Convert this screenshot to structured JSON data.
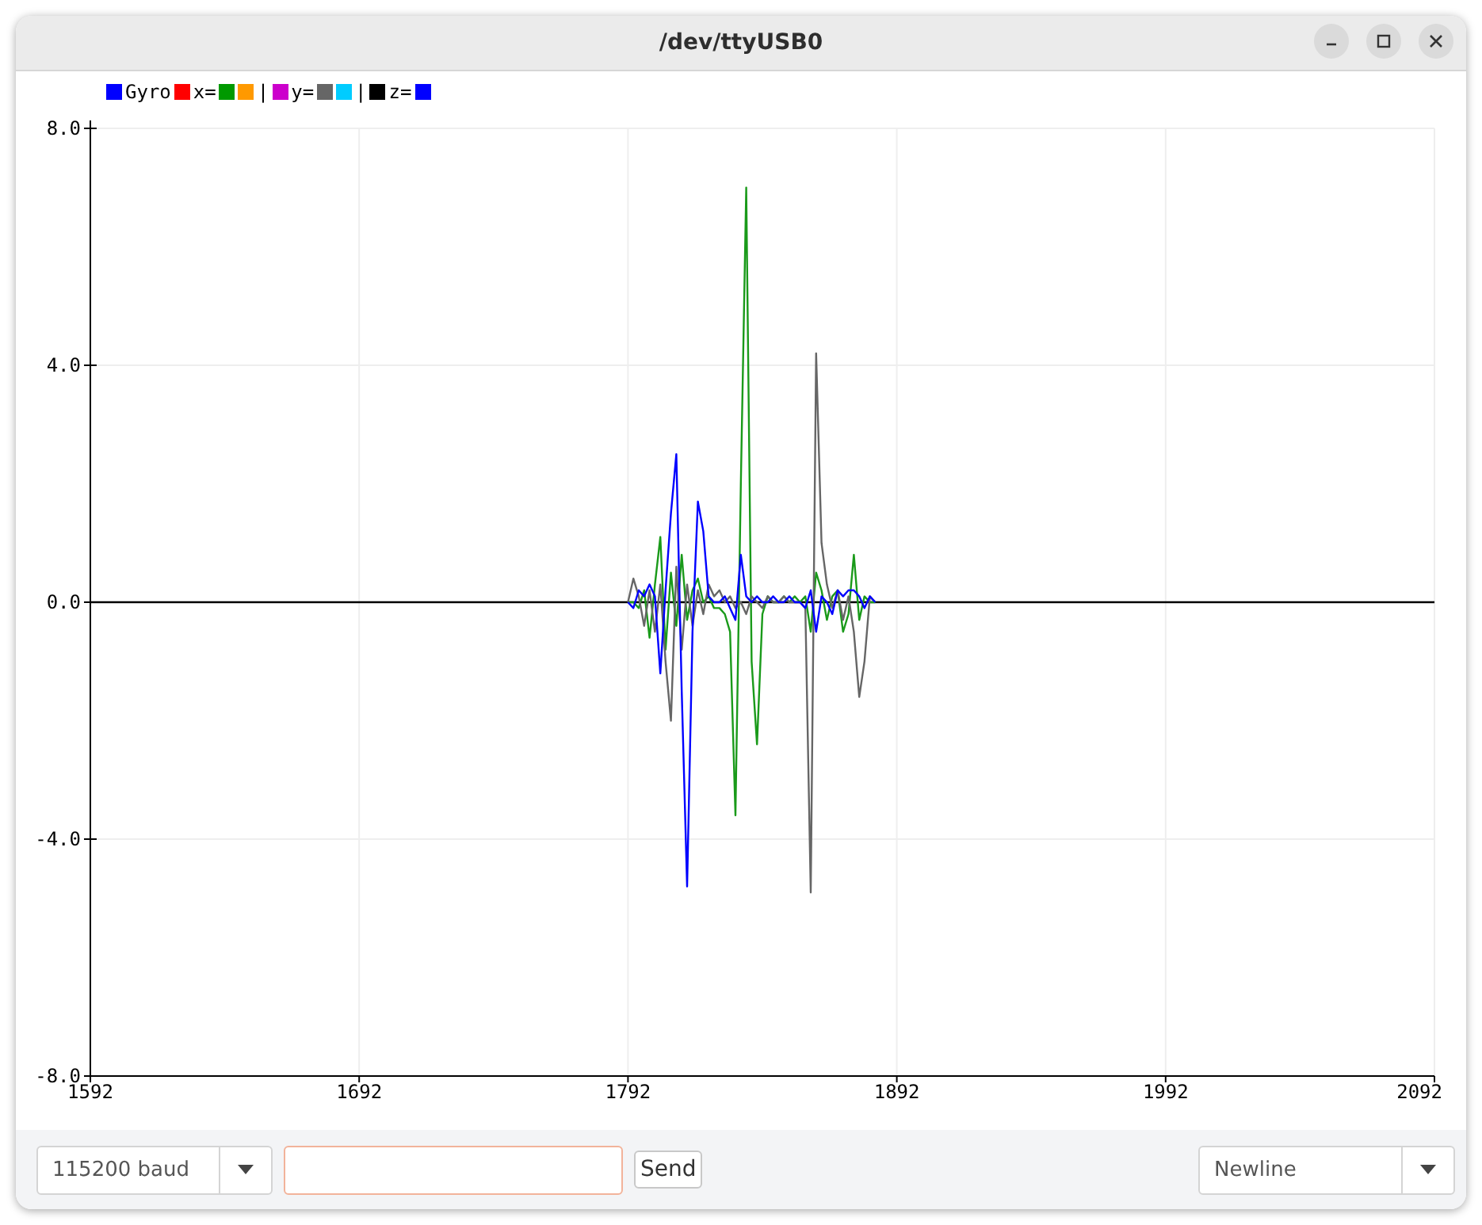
{
  "window": {
    "title": "/dev/ttyUSB0"
  },
  "legend": [
    {
      "color": "#0000ff",
      "label": "Gyro"
    },
    {
      "color": "#ff0000",
      "label": "x="
    },
    {
      "color": "#009900"
    },
    {
      "color": "#ff9900",
      "label": "|"
    },
    {
      "color": "#cc00cc",
      "label": "y="
    },
    {
      "color": "#666666"
    },
    {
      "color": "#00ccff",
      "label": "|"
    },
    {
      "color": "#000000",
      "label": "z="
    },
    {
      "color": "#0000ff"
    }
  ],
  "chart_data": {
    "type": "line",
    "x": [
      1592,
      1792,
      1794,
      1796,
      1798,
      1800,
      1802,
      1804,
      1806,
      1808,
      1810,
      1812,
      1814,
      1816,
      1818,
      1820,
      1822,
      1824,
      1826,
      1828,
      1830,
      1832,
      1834,
      1836,
      1838,
      1840,
      1842,
      1844,
      1846,
      1848,
      1850,
      1852,
      1854,
      1856,
      1858,
      1860,
      1862,
      1864,
      1866,
      1868,
      1870,
      1872,
      1874,
      1876,
      1878,
      1880,
      1882,
      1884,
      2092
    ],
    "series": [
      {
        "color": "#000000",
        "values": [
          0,
          0,
          0,
          0,
          0,
          0,
          0,
          0,
          0,
          0,
          0,
          0,
          0,
          0,
          0,
          0,
          0,
          0,
          0,
          0,
          0,
          0,
          0,
          0,
          0,
          0,
          0,
          0,
          0,
          0,
          0,
          0,
          0,
          0,
          0,
          0,
          0,
          0,
          0,
          0,
          0,
          0,
          0,
          0,
          0,
          0,
          0,
          0,
          0
        ]
      },
      {
        "color": "#1a9a1a",
        "values": [
          null,
          0,
          0,
          -0.1,
          0.2,
          -0.6,
          0.3,
          1.1,
          -0.8,
          0.5,
          -0.4,
          0.8,
          -0.3,
          0.2,
          0.4,
          0,
          0.1,
          -0.1,
          -0.1,
          -0.2,
          -0.5,
          -3.6,
          2.0,
          7.0,
          -1.0,
          -2.4,
          -0.2,
          0.1,
          0,
          0,
          0.1,
          0,
          0.1,
          0,
          0.1,
          -0.5,
          0.5,
          0.2,
          -0.3,
          0.1,
          0.2,
          -0.5,
          -0.2,
          0.8,
          -0.3,
          0.1,
          0,
          0,
          null
        ]
      },
      {
        "color": "#666666",
        "values": [
          null,
          0,
          0.4,
          0.1,
          -0.4,
          0.2,
          -0.5,
          0.3,
          -1.0,
          -2.0,
          0.6,
          -0.8,
          0.3,
          -0.4,
          0.2,
          -0.2,
          0.3,
          0.1,
          0.2,
          0,
          0.1,
          -0.1,
          0,
          -0.2,
          0.1,
          0,
          -0.1,
          0.1,
          0,
          0,
          0.1,
          0,
          0,
          0,
          -0.1,
          -4.9,
          4.2,
          1.0,
          0.3,
          -0.1,
          0.2,
          -0.3,
          0.1,
          -0.5,
          -1.6,
          -1.0,
          0.1,
          0,
          null
        ]
      },
      {
        "color": "#0000ff",
        "values": [
          null,
          0,
          -0.1,
          0.2,
          0.1,
          0.3,
          0.1,
          -1.2,
          0.2,
          1.5,
          2.5,
          -1.5,
          -4.8,
          -0.5,
          1.7,
          1.2,
          0.1,
          0,
          0,
          0.1,
          -0.1,
          -0.3,
          0.8,
          0.1,
          0,
          0.1,
          0,
          0,
          0.1,
          0,
          0,
          0.1,
          0,
          0,
          -0.1,
          0.2,
          -0.5,
          0.1,
          0,
          -0.2,
          0.2,
          0.1,
          0.2,
          0.2,
          0.1,
          -0.1,
          0.1,
          0,
          null
        ]
      }
    ],
    "grid": true,
    "xlim": [
      1592,
      2092
    ],
    "ylim": [
      -8,
      8
    ],
    "xticks": [
      1592,
      1692,
      1792,
      1892,
      1992,
      2092
    ],
    "yticks": [
      {
        "value": 8,
        "label": "8.0"
      },
      {
        "value": 4,
        "label": "4.0"
      },
      {
        "value": 0,
        "label": "0.0"
      },
      {
        "value": -4,
        "label": "-4.0"
      },
      {
        "value": -8,
        "label": "-8.0"
      }
    ]
  },
  "bottom_bar": {
    "baud_select": {
      "value": "115200 baud"
    },
    "send_button": "Send",
    "line_ending_select": {
      "value": "Newline"
    }
  }
}
